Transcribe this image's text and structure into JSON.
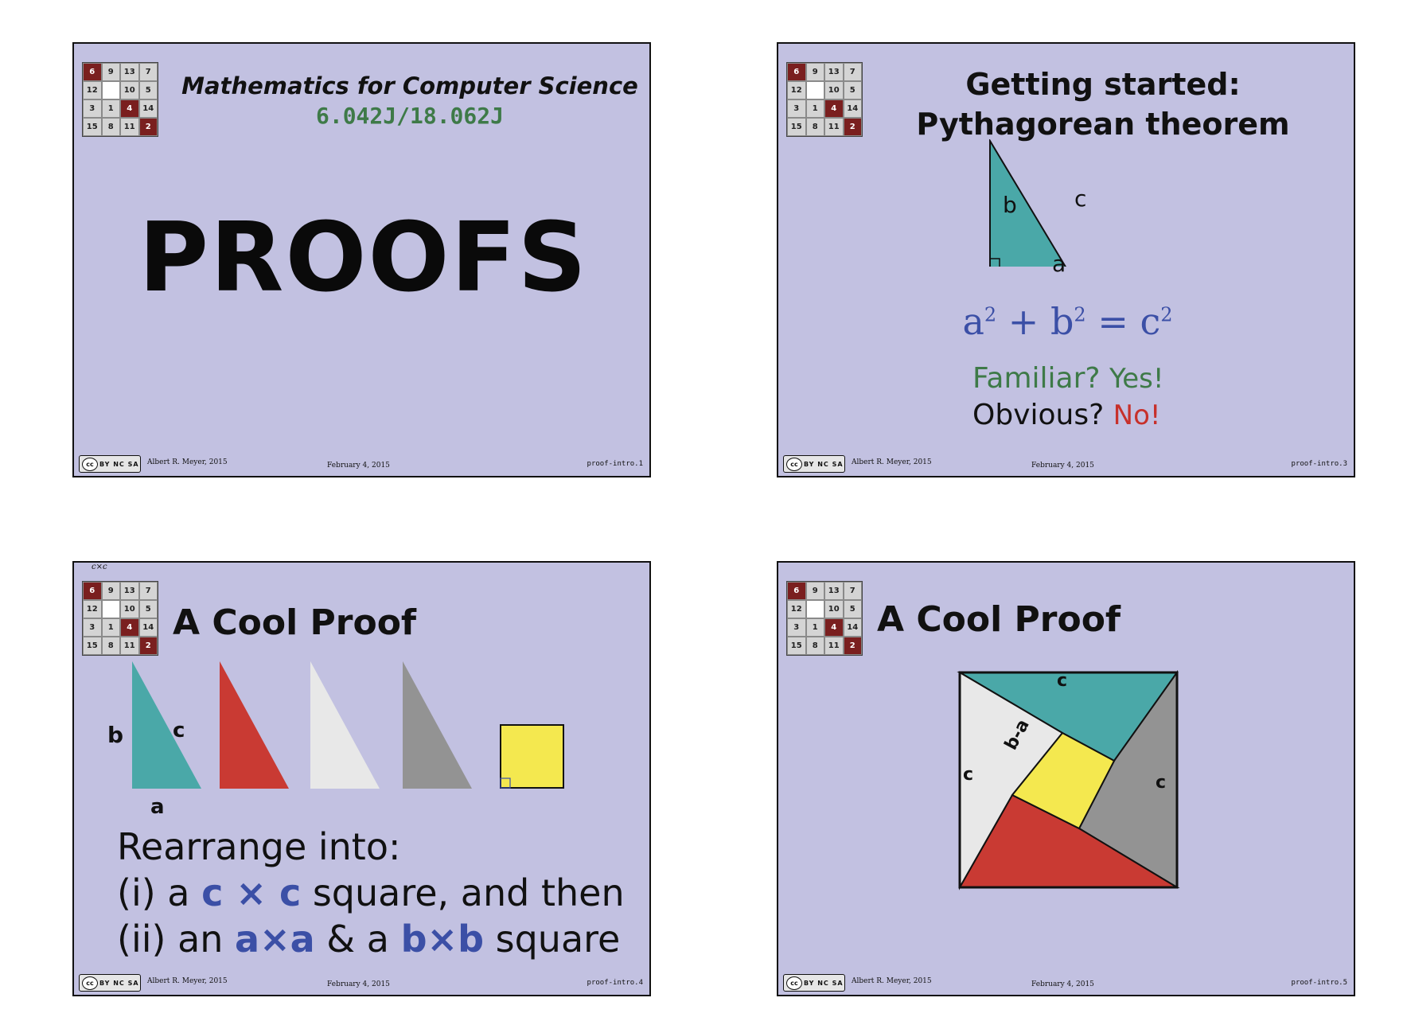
{
  "grid_numbers": [
    "6",
    "9",
    "13",
    "7",
    "12",
    "",
    "10",
    "5",
    "3",
    "1",
    "4",
    "14",
    "15",
    "8",
    "11",
    "2"
  ],
  "footer": {
    "author": "Albert R. Meyer, 2015",
    "date": "February 4, 2015",
    "cc_label": "cc",
    "cc_sub": "BY NC SA"
  },
  "slide1": {
    "course_title": "Mathematics for Computer Science",
    "course_number": "6.042J/18.062J",
    "main_title": "PROOFS",
    "slide_num": "proof-intro.1"
  },
  "slide2": {
    "title_line1": "Getting started:",
    "title_line2": "Pythagorean theorem",
    "label_a": "a",
    "label_b": "b",
    "label_c": "c",
    "eq_a": "a",
    "eq_b": "b",
    "eq_c": "c",
    "eq_exp": "2",
    "eq_plus": "+",
    "eq_equals": "=",
    "familiar": "Familiar?",
    "yes": "Yes!",
    "obvious": "Obvious?",
    "no": "No!",
    "slide_num": "proof-intro.3"
  },
  "slide3": {
    "corner_note": "c×c",
    "title": "A Cool Proof",
    "label_a": "a",
    "label_b": "b",
    "label_c": "c",
    "line1": "Rearrange into:",
    "line2_pre": "(i)  a ",
    "line2_em": "c × c",
    "line2_post": " square, and then",
    "line3_pre": "(ii) an ",
    "line3_em1": "a×a",
    "line3_mid": " & a ",
    "line3_em2": "b×b",
    "line3_post": " square",
    "slide_num": "proof-intro.4"
  },
  "slide4": {
    "title": "A Cool Proof",
    "label_c_top": "c",
    "label_c_left": "c",
    "label_c_right": "c",
    "label_ba": "b-a",
    "slide_num": "proof-intro.5"
  },
  "colors": {
    "background": "#c2c1e1",
    "teal": "#4aa8a8",
    "red": "#c93a33",
    "light": "#e8e8e8",
    "gray": "#939393",
    "yellow": "#f4e84f",
    "green": "#3e7a48",
    "blue": "#3b4fa6"
  }
}
